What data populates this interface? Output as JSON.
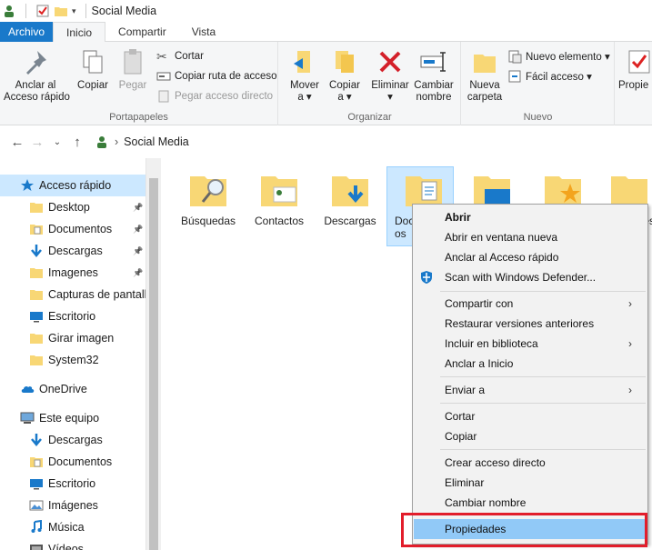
{
  "window": {
    "title": "Social Media"
  },
  "tabs": [
    "Archivo",
    "Inicio",
    "Compartir",
    "Vista"
  ],
  "ribbon": {
    "portapapeles": {
      "label": "Portapapeles",
      "anclar": "Anclar al\nAcceso rápido",
      "copiar": "Copiar",
      "pegar": "Pegar",
      "cortar": "Cortar",
      "copiar_ruta": "Copiar ruta de acceso",
      "pegar_acceso": "Pegar acceso directo"
    },
    "organizar": {
      "label": "Organizar",
      "mover": "Mover\na ▾",
      "copiar": "Copiar\na ▾",
      "eliminar": "Eliminar\n▾",
      "cambiar": "Cambiar\nnombre"
    },
    "nuevo": {
      "label": "Nuevo",
      "carpeta": "Nueva\ncarpeta",
      "nuevo_elemento": "Nuevo elemento ▾",
      "facil_acceso": "Fácil acceso ▾"
    },
    "propiedades": "Propie"
  },
  "address": {
    "crumb": "Social Media"
  },
  "sidebar": {
    "items": [
      {
        "label": "Acceso rápido",
        "icon": "star-icon",
        "pinned": false
      },
      {
        "label": "Desktop",
        "icon": "folder-icon",
        "pinned": true
      },
      {
        "label": "Documentos",
        "icon": "documents-icon",
        "pinned": true
      },
      {
        "label": "Descargas",
        "icon": "download-icon",
        "pinned": true
      },
      {
        "label": "Imagenes",
        "icon": "folder-icon",
        "pinned": true
      },
      {
        "label": "Capturas de pantalla",
        "icon": "folder-icon",
        "pinned": false
      },
      {
        "label": "Escritorio",
        "icon": "desktop-icon",
        "pinned": false
      },
      {
        "label": "Girar imagen",
        "icon": "folder-icon",
        "pinned": false
      },
      {
        "label": "System32",
        "icon": "folder-icon",
        "pinned": false
      },
      {
        "label": "OneDrive",
        "icon": "cloud-icon",
        "pinned": false
      },
      {
        "label": "Este equipo",
        "icon": "computer-icon",
        "pinned": false
      },
      {
        "label": "Descargas",
        "icon": "download-icon",
        "pinned": false
      },
      {
        "label": "Documentos",
        "icon": "documents-icon",
        "pinned": false
      },
      {
        "label": "Escritorio",
        "icon": "desktop-icon",
        "pinned": false
      },
      {
        "label": "Imágenes",
        "icon": "pictures-icon",
        "pinned": false
      },
      {
        "label": "Música",
        "icon": "music-icon",
        "pinned": false
      },
      {
        "label": "Vídeos",
        "icon": "video-icon",
        "pinned": false
      }
    ]
  },
  "folders": [
    {
      "label": "Búsquedas"
    },
    {
      "label": "Contactos"
    },
    {
      "label": "Descargas"
    },
    {
      "label": "Doc\nos"
    },
    {
      "label": ""
    },
    {
      "label": ""
    },
    {
      "label": "es"
    }
  ],
  "context_menu": {
    "abrir": "Abrir",
    "nueva_ventana": "Abrir en ventana nueva",
    "anclar_acceso": "Anclar al Acceso rápido",
    "scan": "Scan with Windows Defender...",
    "compartir": "Compartir con",
    "restaurar": "Restaurar versiones anteriores",
    "biblioteca": "Incluir en biblioteca",
    "anclar_inicio": "Anclar a Inicio",
    "enviar": "Enviar a",
    "cortar": "Cortar",
    "copiar": "Copiar",
    "crear_acceso": "Crear acceso directo",
    "eliminar": "Eliminar",
    "cambiar_nombre": "Cambiar nombre",
    "propiedades": "Propiedades"
  },
  "colors": {
    "accent": "#1979ca",
    "selection": "#cce8ff",
    "highlight": "#91c9f7",
    "callout": "#e21d2b",
    "folder": "#f8d775"
  }
}
